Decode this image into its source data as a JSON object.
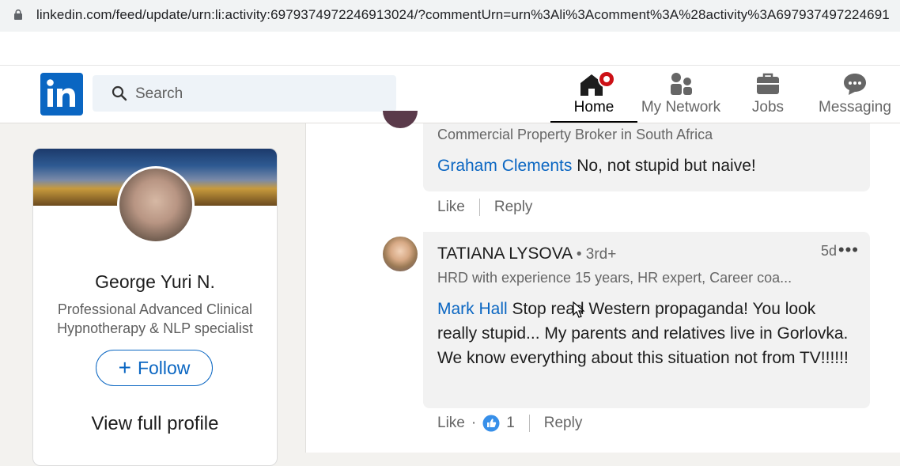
{
  "browser": {
    "url": "linkedin.com/feed/update/urn:li:activity:6979374972246913024/?commentUrn=urn%3Ali%3Acomment%3A%28activity%3A697937497224691"
  },
  "nav": {
    "search_placeholder": "Search",
    "items": [
      {
        "label": "Home",
        "icon": "home-icon",
        "active": true
      },
      {
        "label": "My Network",
        "icon": "network-icon"
      },
      {
        "label": "Jobs",
        "icon": "briefcase-icon"
      },
      {
        "label": "Messaging",
        "icon": "chat-icon"
      }
    ]
  },
  "profile": {
    "name": "George Yuri N.",
    "title": "Professional Advanced Clinical Hypnotherapy & NLP specialist",
    "follow_label": "Follow",
    "view_label": "View full profile"
  },
  "comments": [
    {
      "subtitle": "Commercial Property Broker in South Africa",
      "mention": "Graham Clements",
      "text": " No, not stupid but naive!",
      "actions": {
        "like": "Like",
        "reply": "Reply"
      }
    },
    {
      "author": "TATIANA LYSOVA",
      "degree": "• 3rd+",
      "subtitle": "HRD with experience 15 years, HR expert, Career coa...",
      "time": "5d",
      "mention": "Mark Hall",
      "text": " Stop read Western propaganda! You look really stupid... My parents and relatives live in Gorlovka. We know everything about this situation not from TV!!!!!!",
      "actions": {
        "like": "Like",
        "reactions": "1",
        "reply": "Reply"
      }
    }
  ],
  "colors": {
    "brand": "#0a66c2",
    "notification": "#cc1016",
    "like": "#378fe9"
  }
}
